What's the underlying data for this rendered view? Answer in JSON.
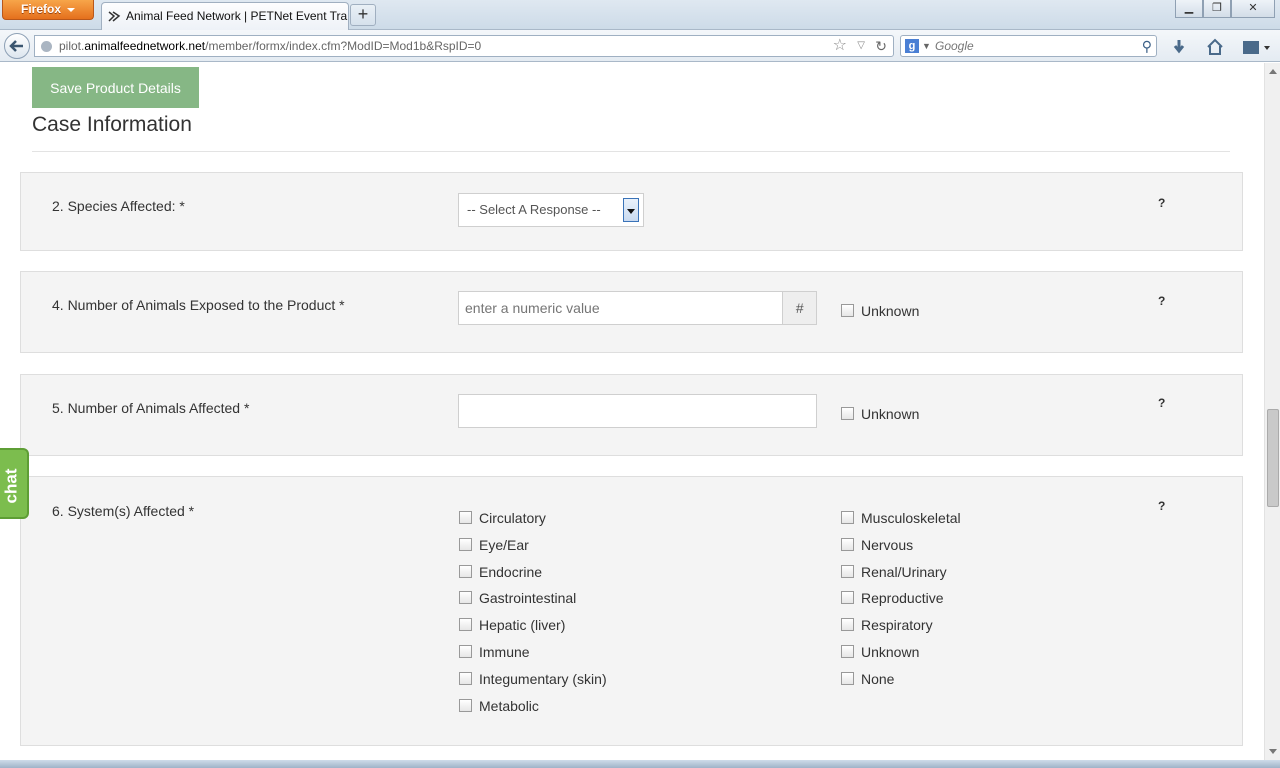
{
  "browser": {
    "menu_label": "Firefox",
    "tab_title": "Animal Feed Network | PETNet Event Tra...",
    "new_tab_label": "+",
    "url_prefix": "pilot.",
    "url_host": "animalfeednetwork.net",
    "url_path": "/member/formx/index.cfm?ModID=Mod1b&RspID=0",
    "search_placeholder": "Google"
  },
  "form": {
    "save_label": "Save Product Details",
    "section_title": "Case Information",
    "help_label": "?",
    "q2": {
      "label": "2. Species Affected: *",
      "select_value": "-- Select A Response --"
    },
    "q4": {
      "label": "4. Number of Animals Exposed to the Product *",
      "placeholder": "enter a numeric value",
      "addon": "#",
      "unknown_label": "Unknown"
    },
    "q5": {
      "label": "5. Number of Animals Affected *",
      "unknown_label": "Unknown"
    },
    "q6": {
      "label": "6. System(s) Affected *",
      "col1": [
        "Circulatory",
        "Eye/Ear",
        "Endocrine",
        "Gastrointestinal",
        "Hepatic (liver)",
        "Immune",
        "Integumentary (skin)",
        "Metabolic"
      ],
      "col2": [
        "Musculoskeletal",
        "Nervous",
        "Renal/Urinary",
        "Reproductive",
        "Respiratory",
        "Unknown",
        "None"
      ]
    }
  },
  "chat_label": "chat"
}
